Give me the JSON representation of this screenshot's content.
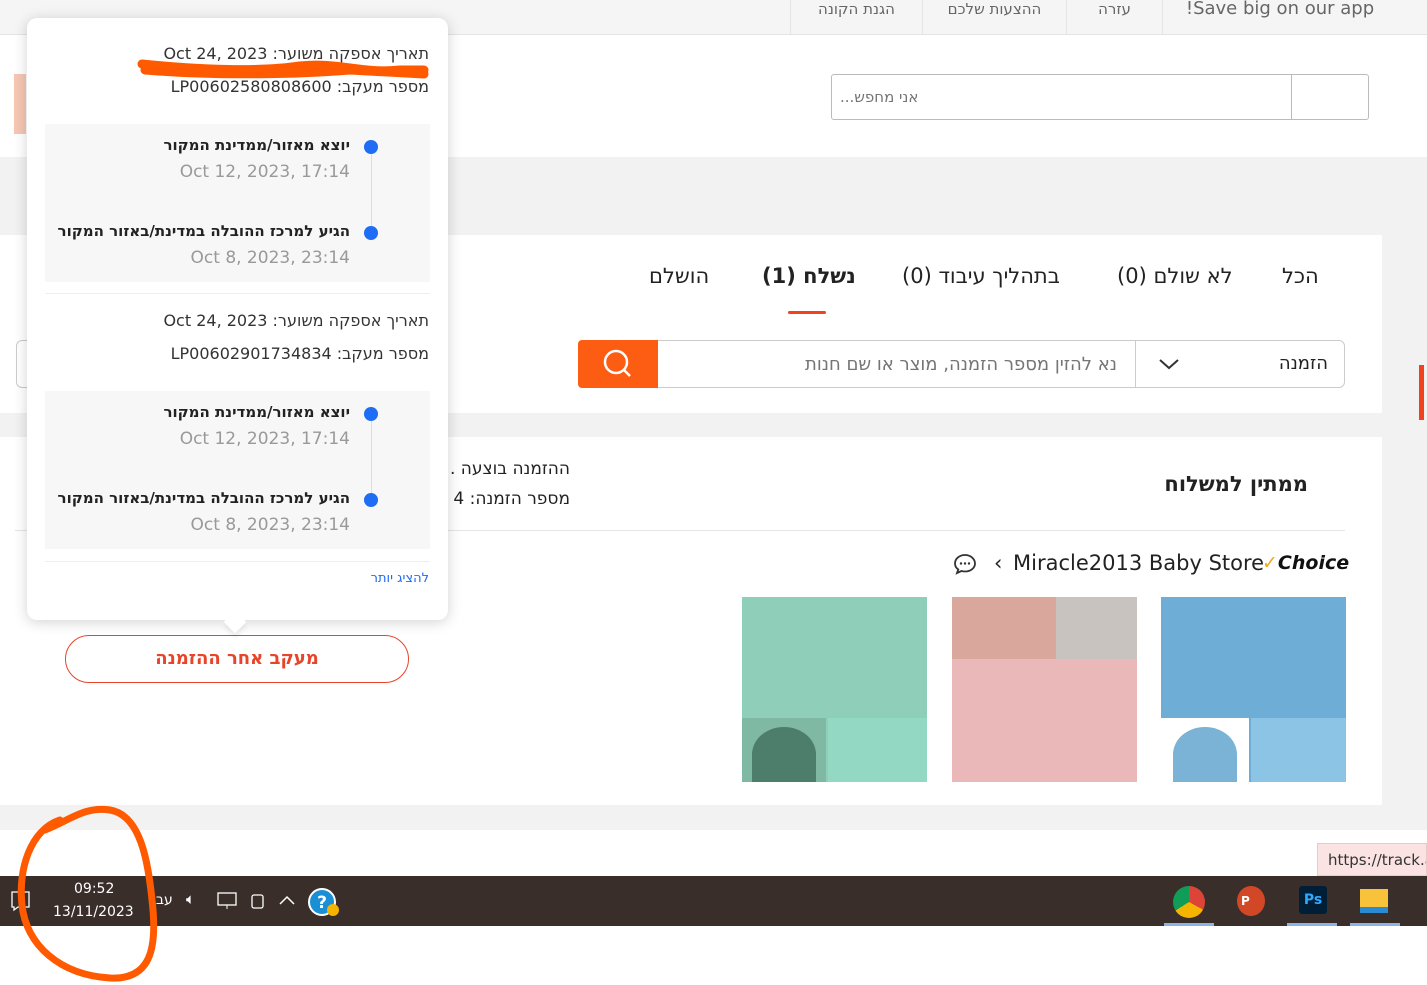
{
  "topnav": {
    "links": [
      "Save big on our app!",
      "עזרה",
      "ההצעות שלכם",
      "הגנת הקונה"
    ]
  },
  "header_search": {
    "placeholder": "אני מחפש..."
  },
  "tabs": [
    {
      "label": "הכל"
    },
    {
      "label": "לא שולם (0)"
    },
    {
      "label": "בתהליך עיבוד (0)"
    },
    {
      "label": "נשלח (1)",
      "active": true
    },
    {
      "label": "הושלם"
    }
  ],
  "order_search": {
    "placeholder": "נא להזין מספר הזמנה, מוצר או שם חנות",
    "type_select": "הזמנה"
  },
  "order": {
    "status": "ממתין למשלוח",
    "placed": "ההזמנה בוצעה .",
    "order_number": "מספר הזמנה: 4",
    "choice_label": "Choice",
    "store_name": "Miracle2013 Baby Store",
    "track_button": "מעקב אחר ההזמנה"
  },
  "popup": {
    "packages": [
      {
        "est_delivery": "תאריך אספקה משוער: Oct 24, 2023",
        "tracking": "מספר מעקב: LP00602580808600",
        "events": [
          {
            "title": "יוצא מאזור/ממדינת המקור",
            "date": "Oct 12, 2023, 17:14"
          },
          {
            "title": "הגיע למרכז ההובלה במדינת/באזור המקור",
            "date": "Oct 8, 2023, 23:14"
          }
        ]
      },
      {
        "est_delivery": "תאריך אספקה משוער: Oct 24, 2023",
        "tracking": "מספר מעקב: LP00602901734834",
        "events": [
          {
            "title": "יוצא מאזור/ממדינת המקור",
            "date": "Oct 12, 2023, 17:14"
          },
          {
            "title": "הגיע למרכז ההובלה במדינת/באזור המקור",
            "date": "Oct 8, 2023, 23:14"
          }
        ]
      }
    ],
    "show_more": "להציג יותר"
  },
  "tooltip": {
    "url": "https://track.a"
  },
  "taskbar": {
    "time": "09:52",
    "date": "13/11/2023",
    "lang": "עבר"
  },
  "colors": {
    "accent": "#fd5c13",
    "link": "#1f6cf5",
    "annotation": "#ff5a00"
  }
}
